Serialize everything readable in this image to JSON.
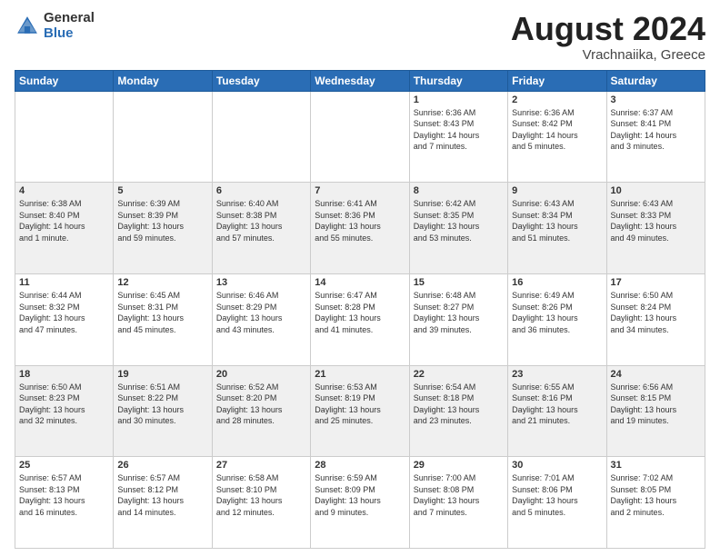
{
  "header": {
    "logo_general": "General",
    "logo_blue": "Blue",
    "title": "August 2024",
    "location": "Vrachnaiika, Greece"
  },
  "calendar": {
    "days_of_week": [
      "Sunday",
      "Monday",
      "Tuesday",
      "Wednesday",
      "Thursday",
      "Friday",
      "Saturday"
    ],
    "weeks": [
      [
        {
          "day": "",
          "info": ""
        },
        {
          "day": "",
          "info": ""
        },
        {
          "day": "",
          "info": ""
        },
        {
          "day": "",
          "info": ""
        },
        {
          "day": "1",
          "info": "Sunrise: 6:36 AM\nSunset: 8:43 PM\nDaylight: 14 hours\nand 7 minutes."
        },
        {
          "day": "2",
          "info": "Sunrise: 6:36 AM\nSunset: 8:42 PM\nDaylight: 14 hours\nand 5 minutes."
        },
        {
          "day": "3",
          "info": "Sunrise: 6:37 AM\nSunset: 8:41 PM\nDaylight: 14 hours\nand 3 minutes."
        }
      ],
      [
        {
          "day": "4",
          "info": "Sunrise: 6:38 AM\nSunset: 8:40 PM\nDaylight: 14 hours\nand 1 minute."
        },
        {
          "day": "5",
          "info": "Sunrise: 6:39 AM\nSunset: 8:39 PM\nDaylight: 13 hours\nand 59 minutes."
        },
        {
          "day": "6",
          "info": "Sunrise: 6:40 AM\nSunset: 8:38 PM\nDaylight: 13 hours\nand 57 minutes."
        },
        {
          "day": "7",
          "info": "Sunrise: 6:41 AM\nSunset: 8:36 PM\nDaylight: 13 hours\nand 55 minutes."
        },
        {
          "day": "8",
          "info": "Sunrise: 6:42 AM\nSunset: 8:35 PM\nDaylight: 13 hours\nand 53 minutes."
        },
        {
          "day": "9",
          "info": "Sunrise: 6:43 AM\nSunset: 8:34 PM\nDaylight: 13 hours\nand 51 minutes."
        },
        {
          "day": "10",
          "info": "Sunrise: 6:43 AM\nSunset: 8:33 PM\nDaylight: 13 hours\nand 49 minutes."
        }
      ],
      [
        {
          "day": "11",
          "info": "Sunrise: 6:44 AM\nSunset: 8:32 PM\nDaylight: 13 hours\nand 47 minutes."
        },
        {
          "day": "12",
          "info": "Sunrise: 6:45 AM\nSunset: 8:31 PM\nDaylight: 13 hours\nand 45 minutes."
        },
        {
          "day": "13",
          "info": "Sunrise: 6:46 AM\nSunset: 8:29 PM\nDaylight: 13 hours\nand 43 minutes."
        },
        {
          "day": "14",
          "info": "Sunrise: 6:47 AM\nSunset: 8:28 PM\nDaylight: 13 hours\nand 41 minutes."
        },
        {
          "day": "15",
          "info": "Sunrise: 6:48 AM\nSunset: 8:27 PM\nDaylight: 13 hours\nand 39 minutes."
        },
        {
          "day": "16",
          "info": "Sunrise: 6:49 AM\nSunset: 8:26 PM\nDaylight: 13 hours\nand 36 minutes."
        },
        {
          "day": "17",
          "info": "Sunrise: 6:50 AM\nSunset: 8:24 PM\nDaylight: 13 hours\nand 34 minutes."
        }
      ],
      [
        {
          "day": "18",
          "info": "Sunrise: 6:50 AM\nSunset: 8:23 PM\nDaylight: 13 hours\nand 32 minutes."
        },
        {
          "day": "19",
          "info": "Sunrise: 6:51 AM\nSunset: 8:22 PM\nDaylight: 13 hours\nand 30 minutes."
        },
        {
          "day": "20",
          "info": "Sunrise: 6:52 AM\nSunset: 8:20 PM\nDaylight: 13 hours\nand 28 minutes."
        },
        {
          "day": "21",
          "info": "Sunrise: 6:53 AM\nSunset: 8:19 PM\nDaylight: 13 hours\nand 25 minutes."
        },
        {
          "day": "22",
          "info": "Sunrise: 6:54 AM\nSunset: 8:18 PM\nDaylight: 13 hours\nand 23 minutes."
        },
        {
          "day": "23",
          "info": "Sunrise: 6:55 AM\nSunset: 8:16 PM\nDaylight: 13 hours\nand 21 minutes."
        },
        {
          "day": "24",
          "info": "Sunrise: 6:56 AM\nSunset: 8:15 PM\nDaylight: 13 hours\nand 19 minutes."
        }
      ],
      [
        {
          "day": "25",
          "info": "Sunrise: 6:57 AM\nSunset: 8:13 PM\nDaylight: 13 hours\nand 16 minutes."
        },
        {
          "day": "26",
          "info": "Sunrise: 6:57 AM\nSunset: 8:12 PM\nDaylight: 13 hours\nand 14 minutes."
        },
        {
          "day": "27",
          "info": "Sunrise: 6:58 AM\nSunset: 8:10 PM\nDaylight: 13 hours\nand 12 minutes."
        },
        {
          "day": "28",
          "info": "Sunrise: 6:59 AM\nSunset: 8:09 PM\nDaylight: 13 hours\nand 9 minutes."
        },
        {
          "day": "29",
          "info": "Sunrise: 7:00 AM\nSunset: 8:08 PM\nDaylight: 13 hours\nand 7 minutes."
        },
        {
          "day": "30",
          "info": "Sunrise: 7:01 AM\nSunset: 8:06 PM\nDaylight: 13 hours\nand 5 minutes."
        },
        {
          "day": "31",
          "info": "Sunrise: 7:02 AM\nSunset: 8:05 PM\nDaylight: 13 hours\nand 2 minutes."
        }
      ]
    ]
  }
}
